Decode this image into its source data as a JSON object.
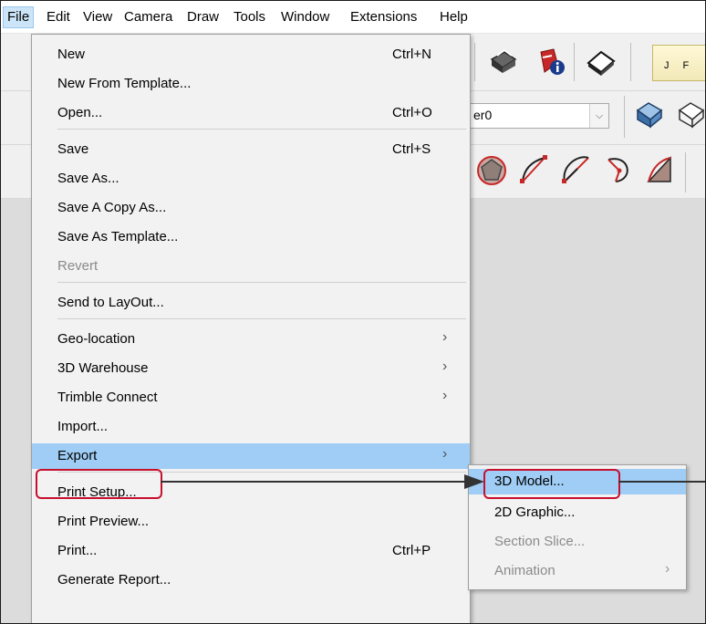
{
  "menubar": {
    "items": [
      "File",
      "Edit",
      "View",
      "Camera",
      "Draw",
      "Tools",
      "Window",
      "Extensions",
      "Help"
    ],
    "active": "File"
  },
  "toolbar": {
    "layer_value": "er0",
    "timeline_label": "J F"
  },
  "file_menu": {
    "items": [
      {
        "label": "New",
        "shortcut": "Ctrl+N"
      },
      {
        "label": "New From Template..."
      },
      {
        "label": "Open...",
        "shortcut": "Ctrl+O"
      },
      {
        "label": "Save",
        "shortcut": "Ctrl+S"
      },
      {
        "label": "Save As..."
      },
      {
        "label": "Save A Copy As..."
      },
      {
        "label": "Save As Template..."
      },
      {
        "label": "Revert",
        "disabled": true
      },
      {
        "label": "Send to LayOut..."
      },
      {
        "label": "Geo-location",
        "submenu": true
      },
      {
        "label": "3D Warehouse",
        "submenu": true
      },
      {
        "label": "Trimble Connect",
        "submenu": true
      },
      {
        "label": "Import..."
      },
      {
        "label": "Export",
        "submenu": true,
        "highlighted": true
      },
      {
        "label": "Print Setup..."
      },
      {
        "label": "Print Preview..."
      },
      {
        "label": "Print...",
        "shortcut": "Ctrl+P"
      },
      {
        "label": "Generate Report..."
      }
    ]
  },
  "export_submenu": {
    "items": [
      {
        "label": "3D Model...",
        "highlighted": true
      },
      {
        "label": "2D Graphic..."
      },
      {
        "label": "Section Slice...",
        "disabled": true
      },
      {
        "label": "Animation",
        "disabled": true,
        "submenu": true
      }
    ]
  },
  "glyphs": {
    "submenu_arrow": "›",
    "dropdown_arrow": "⌵"
  },
  "colors": {
    "highlight": "#9fcdf5",
    "callout": "#c8102e",
    "menu_bg": "#f2f2f2"
  }
}
